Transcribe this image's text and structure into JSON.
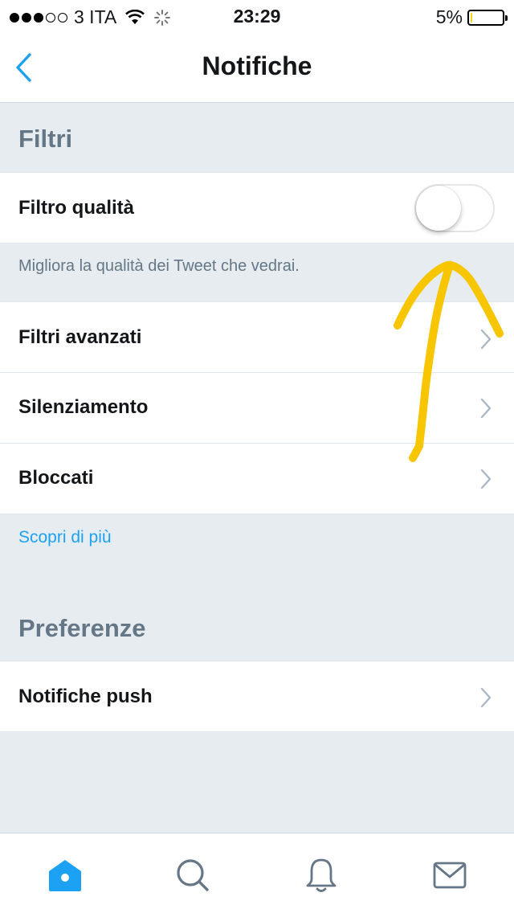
{
  "status_bar": {
    "carrier": "3 ITA",
    "time": "23:29",
    "battery": "5%",
    "battery_level": 0.05,
    "signal_bars": 3,
    "signal_total": 5
  },
  "nav": {
    "title": "Notifiche",
    "back_icon": "chevron-left-icon"
  },
  "filters": {
    "title": "Filtri",
    "quality_filter": {
      "label": "Filtro qualità",
      "enabled": false
    },
    "helper": "Migliora la qualità dei Tweet che vedrai.",
    "items": [
      {
        "label": "Filtri avanzati"
      },
      {
        "label": "Silenziamento"
      },
      {
        "label": "Bloccati"
      }
    ],
    "learn_more": "Scopri di più"
  },
  "preferences": {
    "title": "Preferenze",
    "items": [
      {
        "label": "Notifiche push"
      }
    ]
  },
  "tabs": [
    {
      "icon": "home-icon",
      "active": true
    },
    {
      "icon": "search-icon",
      "active": false
    },
    {
      "icon": "bell-icon",
      "active": false
    },
    {
      "icon": "mail-icon",
      "active": false
    }
  ],
  "colors": {
    "accent": "#1da1f2",
    "annotation": "#f7c600",
    "section_bg": "#e6ecf0",
    "section_text": "#657786"
  }
}
